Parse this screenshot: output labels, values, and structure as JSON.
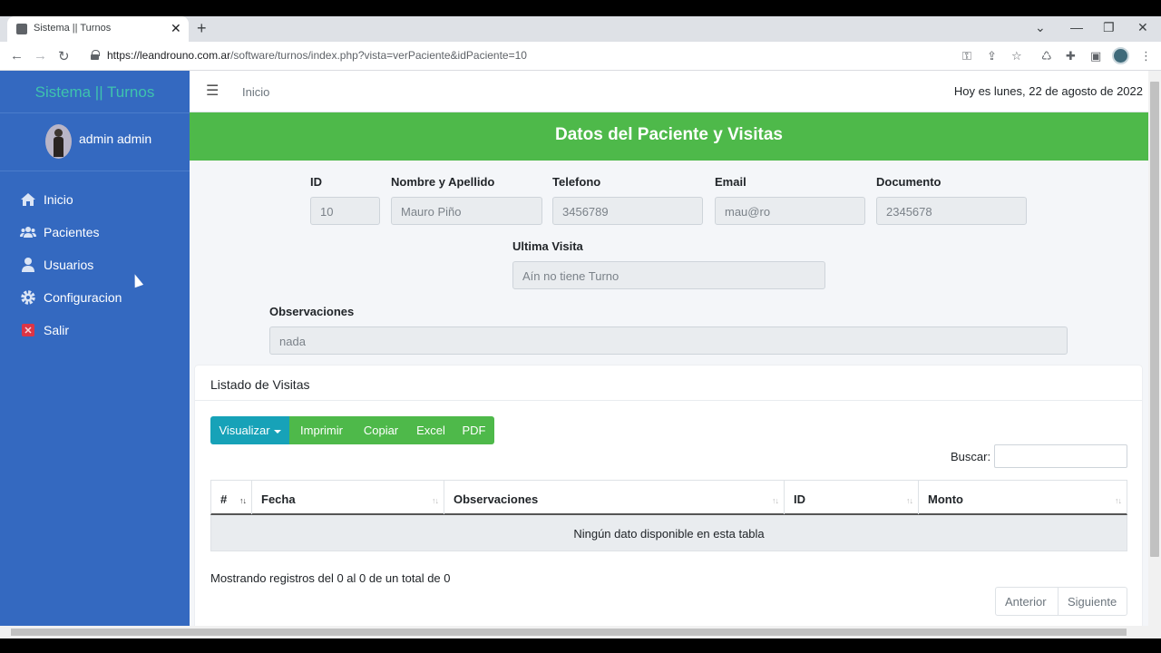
{
  "browser": {
    "tab_title": "Sistema || Turnos",
    "tab_close": "✕",
    "new_tab": "+",
    "url_domain": "https://leandrouno.com.ar",
    "url_path": "/software/turnos/index.php?vista=verPaciente&idPaciente=10"
  },
  "sidebar": {
    "brand": "Sistema || Turnos",
    "user_name": "admin admin",
    "items": [
      {
        "label": "Inicio",
        "icon": "home-icon"
      },
      {
        "label": "Pacientes",
        "icon": "users-icon"
      },
      {
        "label": "Usuarios",
        "icon": "user-icon"
      },
      {
        "label": "Configuracion",
        "icon": "gear-icon"
      },
      {
        "label": "Salir",
        "icon": "exit-icon"
      }
    ]
  },
  "topnav": {
    "breadcrumb": "Inicio",
    "date": "Hoy es lunes, 22 de agosto de 2022"
  },
  "header": {
    "title": "Datos del Paciente y Visitas"
  },
  "patient": {
    "id_label": "ID",
    "id_value": "10",
    "name_label": "Nombre y Apellido",
    "name_value": "Mauro Piño",
    "phone_label": "Telefono",
    "phone_value": "3456789",
    "email_label": "Email",
    "email_value": "mau@ro",
    "doc_label": "Documento",
    "doc_value": "2345678",
    "last_visit_label": "Ultima Visita",
    "last_visit_value": "Aín no tiene Turno",
    "obs_label": "Observaciones",
    "obs_value": "nada"
  },
  "visits": {
    "title": "Listado de Visitas",
    "buttons": {
      "visualizar": "Visualizar",
      "imprimir": "Imprimir",
      "copiar": "Copiar",
      "excel": "Excel",
      "pdf": "PDF"
    },
    "search_label": "Buscar:",
    "columns": [
      "#",
      "Fecha",
      "Observaciones",
      "ID",
      "Monto"
    ],
    "empty_message": "Ningún dato disponible en esta tabla",
    "info": "Mostrando registros del 0 al 0 de un total de 0",
    "prev": "Anterior",
    "next": "Siguiente"
  },
  "colors": {
    "sidebar": "#3469c0",
    "brand_text": "#3ec3ad",
    "header_green": "#4eb94a",
    "visualizar_button": "#17a2b8"
  }
}
